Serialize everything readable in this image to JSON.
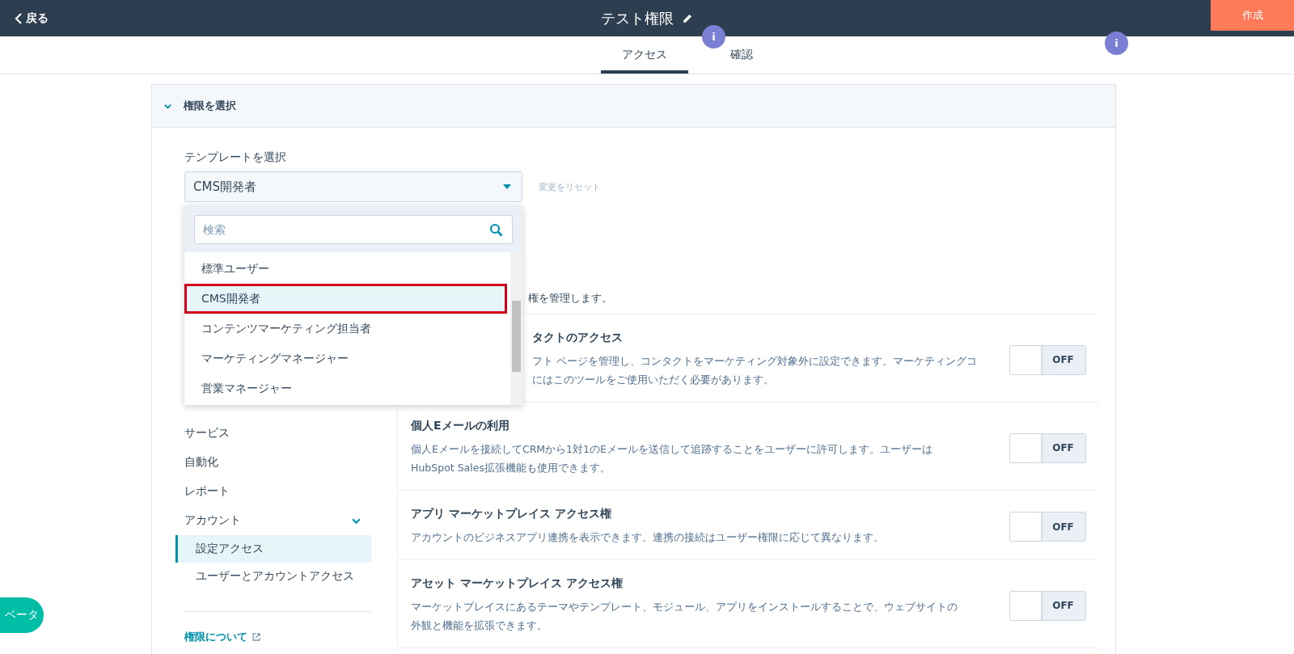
{
  "topbar": {
    "back": "戻る",
    "title": "テスト権限",
    "create": "作成"
  },
  "tabs": [
    {
      "label": "アクセス",
      "selected": true
    },
    {
      "label": "確認",
      "selected": false
    }
  ],
  "markers": [
    "i",
    "i"
  ],
  "section": {
    "title": "権限を選択",
    "expanded": true
  },
  "template": {
    "label": "テンプレートを選択",
    "value": "CMS開発者",
    "reset": "変更をリセット"
  },
  "dropdown": {
    "placeholder": "検索",
    "options": [
      {
        "label": "標準ユーザー",
        "selected": false
      },
      {
        "label": "CMS開発者",
        "selected": true
      },
      {
        "label": "コンテンツマーケティング担当者",
        "selected": false
      },
      {
        "label": "マーケティングマネージャー",
        "selected": false
      },
      {
        "label": "営業マネージャー",
        "selected": false
      }
    ]
  },
  "nav": {
    "items": [
      {
        "label": "サービス",
        "expanded": false
      },
      {
        "label": "自動化",
        "expanded": false
      },
      {
        "label": "レポート",
        "expanded": false
      },
      {
        "label": "アカウント",
        "expanded": true,
        "children": [
          {
            "label": "設定アクセス",
            "selected": true
          },
          {
            "label": "ユーザーとアカウントアクセス",
            "selected": false
          }
        ]
      }
    ],
    "link": "権限について"
  },
  "intro": "権を管理します。",
  "permissions": [
    {
      "kind": "partly_hidden",
      "title": "タクトのアクセス",
      "description": "フト ページを管理し、コンタクトをマーケティング対象外に設定できます。マーケティングコ",
      "description_2": "にはこのツールをご使用いただく必要があります。",
      "toggle": "OFF",
      "on": false
    },
    {
      "kind": "full",
      "title": "個人Eメールの利用",
      "description": "個人Eメールを接続してCRMから1対1のEメールを送信して追跡することをユーザーに許可します。ユーザーは",
      "description_2": "HubSpot Sales拡張機能も使用できます。",
      "toggle": "OFF",
      "on": false
    },
    {
      "kind": "full",
      "title": "アプリ マーケットプレイス アクセス権",
      "description": "アカウントのビジネスアプリ連携を表示できます。連携の接続はユーザー権限に応じて異なります。",
      "toggle": "OFF",
      "on": false
    },
    {
      "kind": "full",
      "title": "アセット マーケットプレイス アクセス権",
      "description": "マーケットプレイスにあるテーマやテンプレート、モジュール、アプリをインストールすることで、ウェブサイトの",
      "description_2": "外観と機能を拡張できます。",
      "toggle": "OFF",
      "on": false
    }
  ],
  "beta": "ベータ"
}
